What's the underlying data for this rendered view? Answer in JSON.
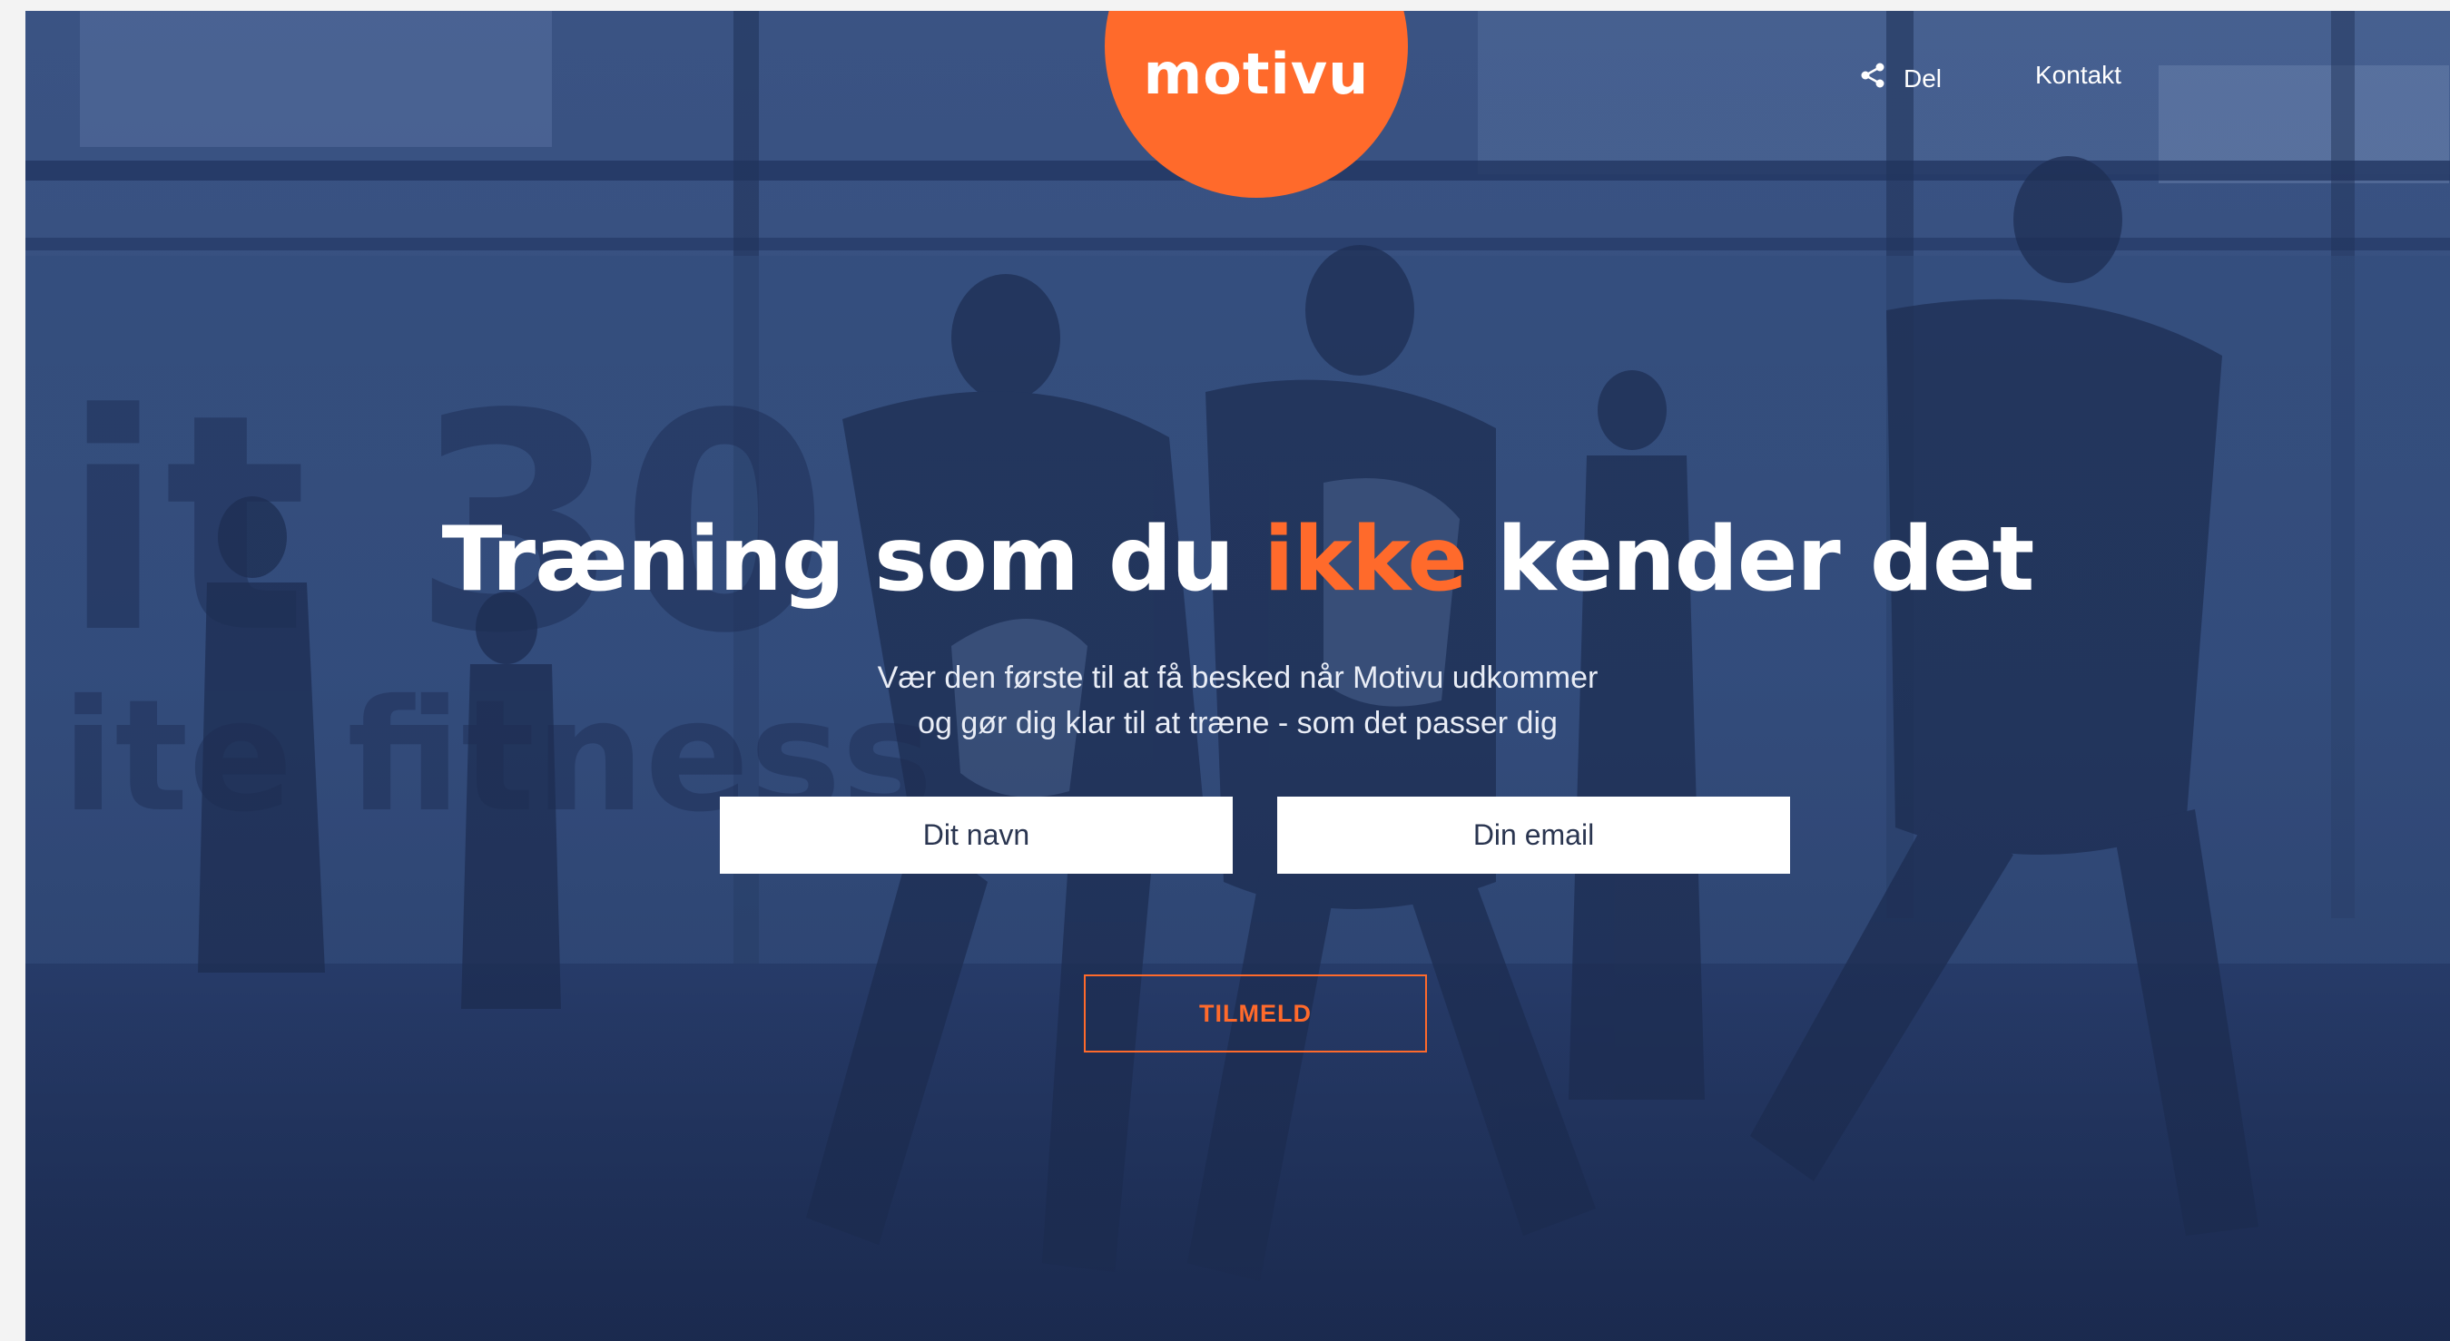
{
  "brand": {
    "logo": "motivu",
    "accent_color": "#ff6a2b",
    "overlay_color": "#263b66"
  },
  "nav": {
    "share_icon": "share-icon",
    "share_label": "Del",
    "contact_label": "Kontakt"
  },
  "hero": {
    "headline_before": "Træning som du ",
    "headline_accent": "ikke",
    "headline_after": " kender det",
    "subline_1": "Vær den første til at få besked når Motivu udkommer",
    "subline_2": "og gør dig klar til at træne - som det passer dig"
  },
  "form": {
    "name_placeholder": "Dit navn",
    "email_placeholder": "Din email",
    "submit_label": "TILMELD"
  }
}
